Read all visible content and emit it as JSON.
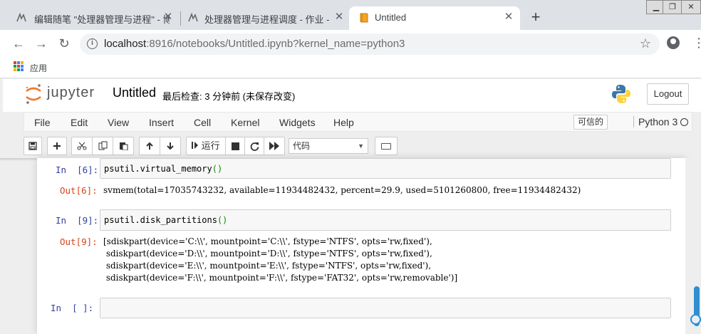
{
  "browser": {
    "tabs": [
      {
        "title": "编辑随笔 \"处理器管理与进程\" - 博",
        "favicon": "cnblogs-icon",
        "active": false
      },
      {
        "title": "处理器管理与进程调度 - 作业 - 博",
        "favicon": "cnblogs-icon",
        "active": false
      },
      {
        "title": "Untitled",
        "favicon": "jupyter-book-icon",
        "active": true
      }
    ],
    "new_tab_glyph": "+",
    "window_controls": [
      "minimize",
      "restore",
      "close"
    ],
    "url_host": "localhost",
    "url_rest": ":8916/notebooks/Untitled.ipynb?kernel_name=python3",
    "bookmarks": {
      "apps_label": "应用"
    }
  },
  "jupyter": {
    "logo_text": "jupyter",
    "notebook_name": "Untitled",
    "checkpoint": "最后检查: 3 分钟前  (未保存改变)",
    "logout_label": "Logout",
    "menu": [
      "File",
      "Edit",
      "View",
      "Insert",
      "Cell",
      "Kernel",
      "Widgets",
      "Help"
    ],
    "trusted_label": "可信的",
    "kernel_name": "Python 3",
    "toolbar": {
      "run_label": "运行",
      "cell_type": "代码",
      "buttons": [
        "save-icon",
        "plus-icon",
        "cut-icon",
        "copy-icon",
        "paste-icon",
        "arrow-up-icon",
        "arrow-down-icon",
        "run-icon",
        "stop-icon",
        "restart-icon",
        "fast-forward-icon",
        "keyboard-icon"
      ]
    }
  },
  "cells": [
    {
      "in_prompt": "In  [6]:",
      "code_fn": "psutil.virtual_memory",
      "code_parens": "()",
      "out_prompt": "Out[6]:",
      "output": "svmem(total=17035743232, available=11934482432, percent=29.9, used=5101260800, free=11934482432)"
    },
    {
      "in_prompt": "In  [9]:",
      "code_fn": "psutil.disk_partitions",
      "code_parens": "()",
      "out_prompt": "Out[9]:",
      "output": "[sdiskpart(device='C:\\\\', mountpoint='C:\\\\', fstype='NTFS', opts='rw,fixed'),\n sdiskpart(device='D:\\\\', mountpoint='D:\\\\', fstype='NTFS', opts='rw,fixed'),\n sdiskpart(device='E:\\\\', mountpoint='E:\\\\', fstype='NTFS', opts='rw,fixed'),\n sdiskpart(device='F:\\\\', mountpoint='F:\\\\', fstype='FAT32', opts='rw,removable')]"
    },
    {
      "in_prompt": "In  [ ]:",
      "code_fn": "",
      "code_parens": ""
    }
  ],
  "colors": {
    "prompt_in": "#303f9f",
    "prompt_out": "#d84315",
    "paren": "#0a8d0a",
    "scrollbar": "#2e8ed0",
    "jupyter_orange": "#f37726"
  }
}
